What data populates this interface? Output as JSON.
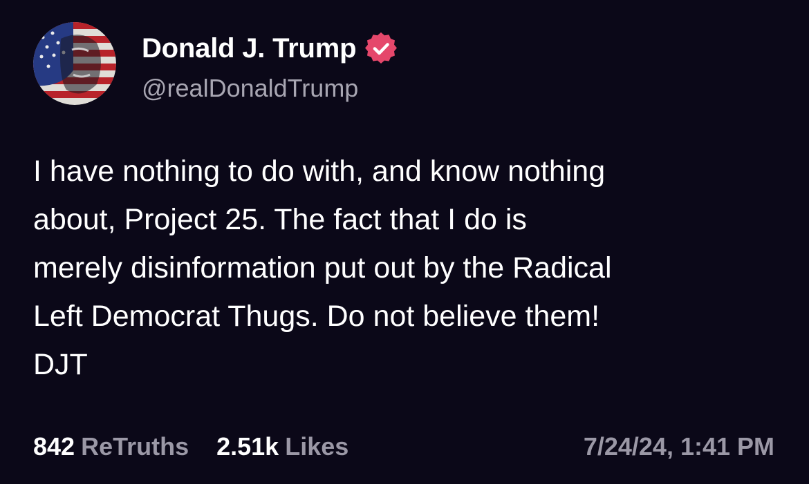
{
  "author": {
    "display_name": "Donald J. Trump",
    "handle": "@realDonaldTrump",
    "avatar_icon": "profile-avatar-flag-portrait",
    "verified_icon": "verified-badge-icon",
    "verified_color": "#e5476b"
  },
  "post": {
    "lines": [
      "I have nothing to do with, and know nothing",
      "about, Project 25. The fact that I do is",
      "merely disinformation put out by the Radical",
      "Left Democrat Thugs. Do not believe them!",
      "DJT"
    ]
  },
  "stats": {
    "retruths_count": "842",
    "retruths_label": "ReTruths",
    "likes_count": "2.51k",
    "likes_label": "Likes"
  },
  "timestamp": "7/24/24, 1:41 PM",
  "colors": {
    "background": "#0b0818",
    "text_primary": "#ffffff",
    "text_secondary": "#a8a6b2"
  }
}
